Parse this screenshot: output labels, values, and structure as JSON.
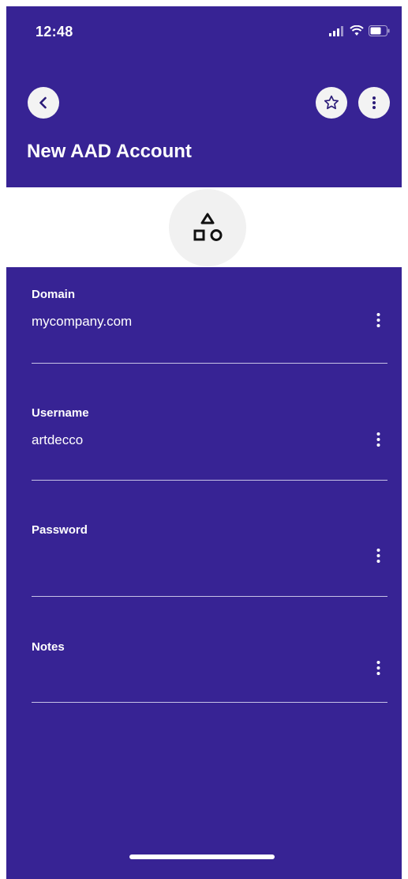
{
  "status_bar": {
    "time": "12:48"
  },
  "header": {
    "title": "New AAD Account",
    "back_icon": "chevron-left-icon",
    "favorite_icon": "star-outline-icon",
    "more_icon": "vertical-ellipsis-icon"
  },
  "entry_icon": "shapes-icon",
  "fields": [
    {
      "label": "Domain",
      "value": "mycompany.com"
    },
    {
      "label": "Username",
      "value": "artdecco"
    },
    {
      "label": "Password",
      "value": ""
    },
    {
      "label": "Notes",
      "value": ""
    }
  ],
  "colors": {
    "primary": "#372394",
    "surface": "#ffffff",
    "button_bg": "#f3f3f3",
    "divider": "#c7c2e6"
  }
}
